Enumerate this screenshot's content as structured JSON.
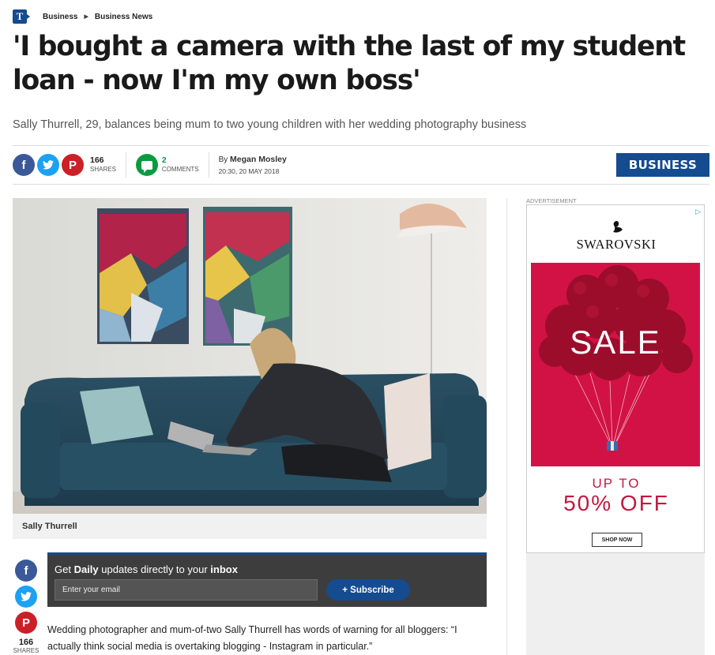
{
  "breadcrumb": {
    "logo": "T",
    "items": [
      "Business",
      "Business News"
    ]
  },
  "headline": "'I bought a camera with the last of my student loan - now I'm my own boss'",
  "standfirst": "Sally Thurrell, 29, balances being mum to two young children with her wedding photography business",
  "share": {
    "count": "166",
    "label": "SHARES",
    "comments_count": "2",
    "comments_label": "COMMENTS"
  },
  "byline": {
    "prefix": "By",
    "author": "Megan Mosley",
    "date": "20:30, 20 MAY 2018"
  },
  "section_badge": "BUSINESS",
  "image": {
    "caption": "Sally Thurrell"
  },
  "ad": {
    "label": "ADVERTISEMENT",
    "brand": "SWAROVSKI",
    "sale": "SALE",
    "upto": "UP TO",
    "off": "50% OFF",
    "cta": "SHOP NOW"
  },
  "newsletter": {
    "pre": "Get ",
    "bold1": "Daily",
    "mid": " updates directly to your ",
    "bold2": "inbox",
    "placeholder": "Enter your email",
    "button": "+ Subscribe"
  },
  "side_share": {
    "count": "166",
    "label": "SHARES"
  },
  "body": "Wedding photographer and mum-of-two Sally Thurrell has words of warning for all bloggers: “I actually think social media is overtaking blogging - Instagram in particular.”",
  "colors": {
    "brand": "#154b8f",
    "facebook": "#3b5998",
    "twitter": "#1da1f2",
    "pinterest": "#cb2027",
    "comments": "#0a9b3f",
    "ad_red": "#d21245"
  }
}
